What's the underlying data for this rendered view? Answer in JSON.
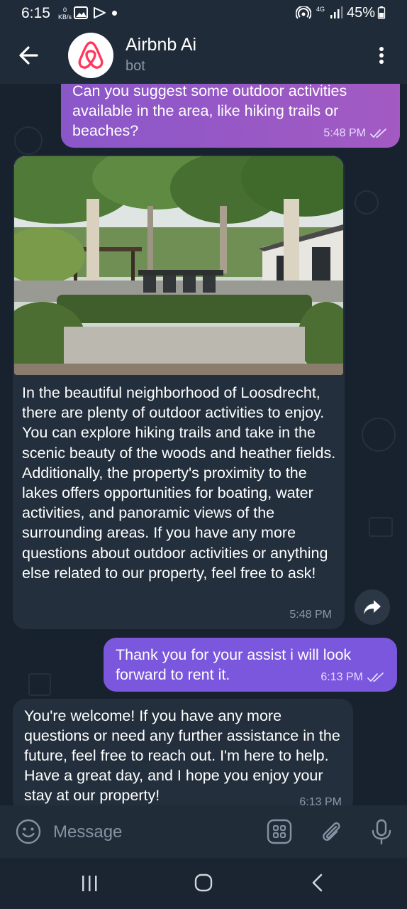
{
  "status_bar": {
    "time": "6:15",
    "data_speed_value": "0",
    "data_speed_unit": "KB/s",
    "network": "4G",
    "battery": "45%"
  },
  "header": {
    "title": "Airbnb Ai",
    "subtitle": "bot"
  },
  "messages": [
    {
      "direction": "outgoing",
      "text": "Can you suggest some outdoor activities available in the area, like hiking trails or beaches?",
      "time": "5:48 PM",
      "status": "read"
    },
    {
      "direction": "incoming",
      "has_image": true,
      "text": "In the beautiful neighborhood of Loosdrecht, there are plenty of outdoor activities to enjoy. You can explore hiking trails and take in the scenic beauty of the woods and heather fields. Additionally, the property's proximity to the lakes offers opportunities for boating, water activities, and panoramic views of the surrounding areas. If you have any more questions about outdoor activities or anything else related to our property, feel free to ask!",
      "time": "5:48 PM"
    },
    {
      "direction": "outgoing",
      "text": "Thank you for your assist i will look forward to rent it.",
      "time": "6:13 PM",
      "status": "read"
    },
    {
      "direction": "incoming",
      "text": "You're welcome! If you have any more questions or need any further assistance in the future, feel free to reach out. I'm here to help. Have a great day, and I hope you enjoy your stay at our property!",
      "time": "6:13 PM"
    }
  ],
  "input": {
    "placeholder": "Message"
  },
  "icons": {
    "back": "arrow-left-icon",
    "menu": "more-vertical-icon",
    "forward": "share-arrow-icon",
    "emoji": "emoji-icon",
    "bot_commands": "grid-icon",
    "attach": "paperclip-icon",
    "mic": "microphone-icon"
  },
  "colors": {
    "outgoing_bubble": "#7a57dc",
    "incoming_bubble": "#232f3c",
    "background": "#18222f",
    "brand": "#ff385c"
  }
}
